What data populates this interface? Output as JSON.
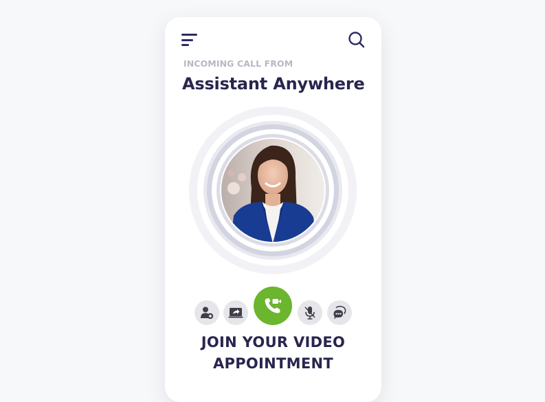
{
  "header": {
    "menu_icon": "hamburger-menu-icon",
    "search_icon": "search-icon"
  },
  "call": {
    "label": "INCOMING CALL FROM",
    "caller_name": "Assistant Anywhere"
  },
  "actions": [
    {
      "name": "add-participant",
      "icon": "add-user-icon"
    },
    {
      "name": "share-screen",
      "icon": "screen-share-icon"
    },
    {
      "name": "answer-video-call",
      "icon": "video-call-icon"
    },
    {
      "name": "mute-microphone",
      "icon": "mic-off-icon"
    },
    {
      "name": "chat",
      "icon": "chat-bubble-icon"
    }
  ],
  "cta": {
    "line1": "JOIN YOUR VIDEO",
    "line2": "APPOINTMENT"
  },
  "colors": {
    "primary_text": "#28264f",
    "muted_text": "#b6b9c3",
    "accept_green": "#6cb52e",
    "action_gray": "#e6e6ea",
    "ring": "#d9dae6"
  }
}
